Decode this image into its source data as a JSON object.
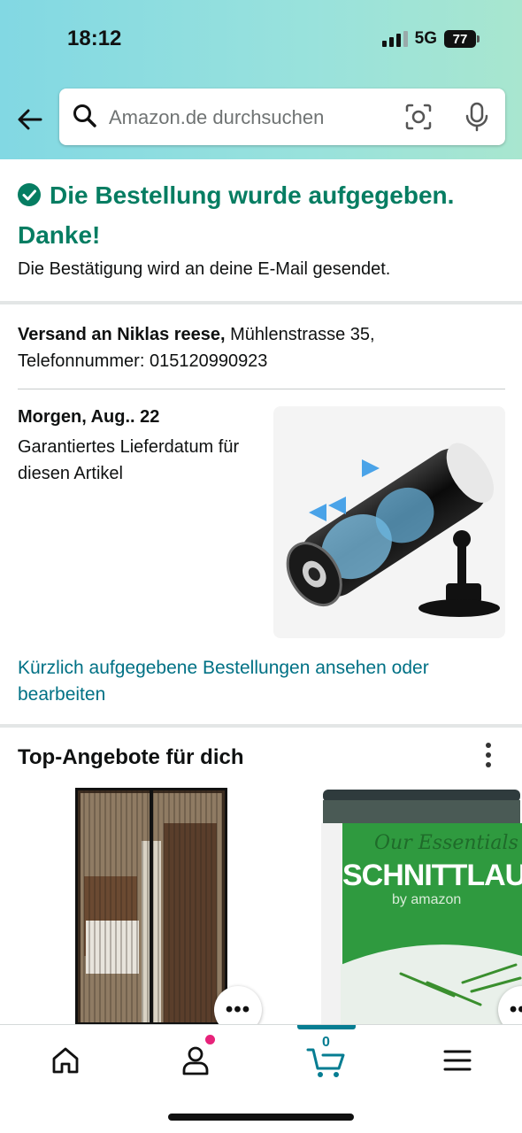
{
  "status_bar": {
    "time": "18:12",
    "network": "5G",
    "battery": "77"
  },
  "search": {
    "placeholder": "Amazon.de durchsuchen"
  },
  "confirmation": {
    "title": "Die Bestellung wurde aufgegeben. Danke!",
    "subtitle": "Die Bestätigung wird an deine E-Mail gesendet."
  },
  "shipping": {
    "label": "Versand an Niklas reese,",
    "address": " Mühlenstrasse 35, Telefonnummer: 015120990923"
  },
  "delivery": {
    "date": "Morgen, Aug.. 22",
    "note": "Garantiertes Lieferdatum für diesen Artikel"
  },
  "orders_link": "Kürzlich aufgegebene Bestellungen ansehen oder bearbeiten",
  "deals": {
    "title": "Top-Angebote für dich",
    "more_label": "•••",
    "items": [
      {
        "icon": "fly-screen-door-image"
      },
      {
        "icon": "chives-jar-image",
        "brand": "Our Essentials",
        "product": "SCHNITTLAUCH",
        "by": "by amazon"
      }
    ]
  },
  "bottom_nav": {
    "cart_count": "0"
  },
  "colors": {
    "accent_green": "#067d62",
    "link": "#007185",
    "cart": "#067d92",
    "badge": "#e7237a"
  }
}
